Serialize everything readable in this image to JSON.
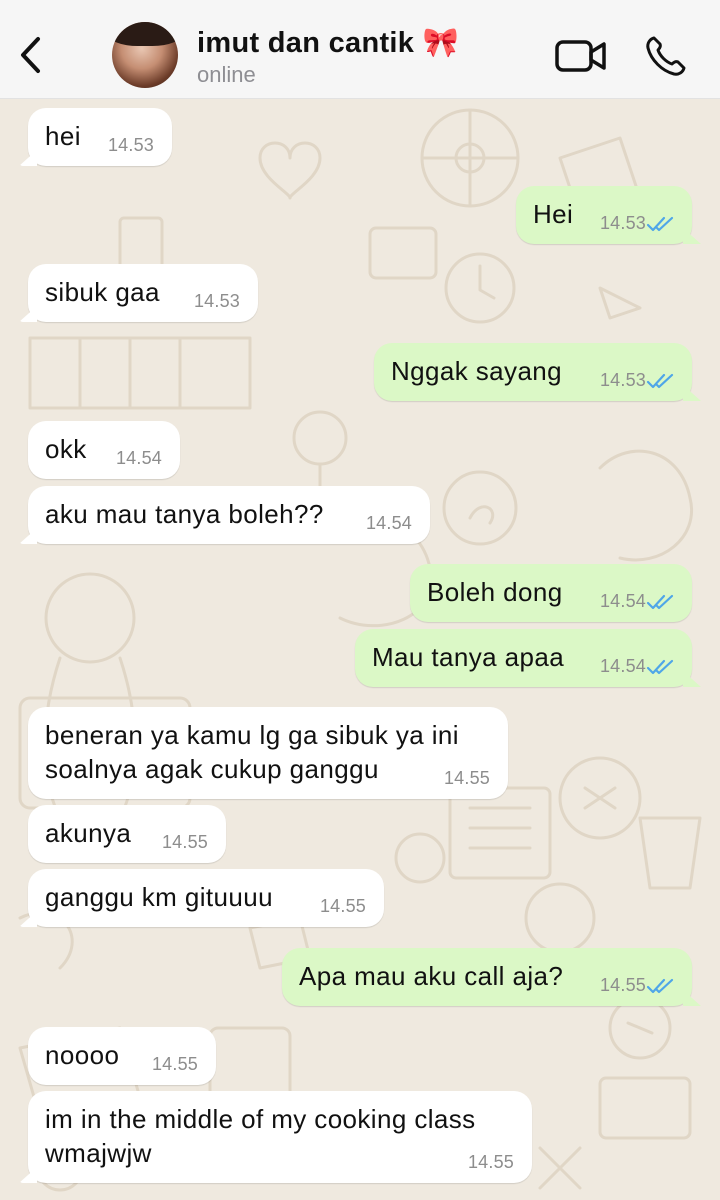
{
  "header": {
    "contact_name": "imut dan cantik",
    "name_emoji": "🎀",
    "status": "online",
    "icons": [
      "back-icon",
      "video-call-icon",
      "voice-call-icon"
    ]
  },
  "colors": {
    "incoming_bubble": "#ffffff",
    "outgoing_bubble": "#dbf8c6",
    "read_ticks": "#4fa6e8",
    "wallpaper": "#efe9df"
  },
  "messages": [
    {
      "dir": "in",
      "text": "hei",
      "time": "14.53"
    },
    {
      "dir": "out",
      "text": "Hei",
      "time": "14.53",
      "read": true
    },
    {
      "dir": "in",
      "text": "sibuk gaa",
      "time": "14.53"
    },
    {
      "dir": "out",
      "text": "Nggak sayang",
      "time": "14.53",
      "read": true
    },
    {
      "dir": "in",
      "text": "okk",
      "time": "14.54"
    },
    {
      "dir": "in",
      "text": "aku mau tanya boleh??",
      "time": "14.54"
    },
    {
      "dir": "out",
      "text": "Boleh dong",
      "time": "14.54",
      "read": true
    },
    {
      "dir": "out",
      "text": "Mau tanya apaa",
      "time": "14.54",
      "read": true
    },
    {
      "dir": "in",
      "text": "beneran ya kamu lg ga sibuk ya ini\nsoalnya agak cukup ganggu",
      "time": "14.55"
    },
    {
      "dir": "in",
      "text": "akunya",
      "time": "14.55"
    },
    {
      "dir": "in",
      "text": "ganggu km gituuuu",
      "time": "14.55"
    },
    {
      "dir": "out",
      "text": "Apa mau aku call aja?",
      "time": "14.55",
      "read": true
    },
    {
      "dir": "in",
      "text": "noooo",
      "time": "14.55"
    },
    {
      "dir": "in",
      "text": "im in the middle of my cooking class\nwmajwjw",
      "time": "14.55"
    }
  ]
}
